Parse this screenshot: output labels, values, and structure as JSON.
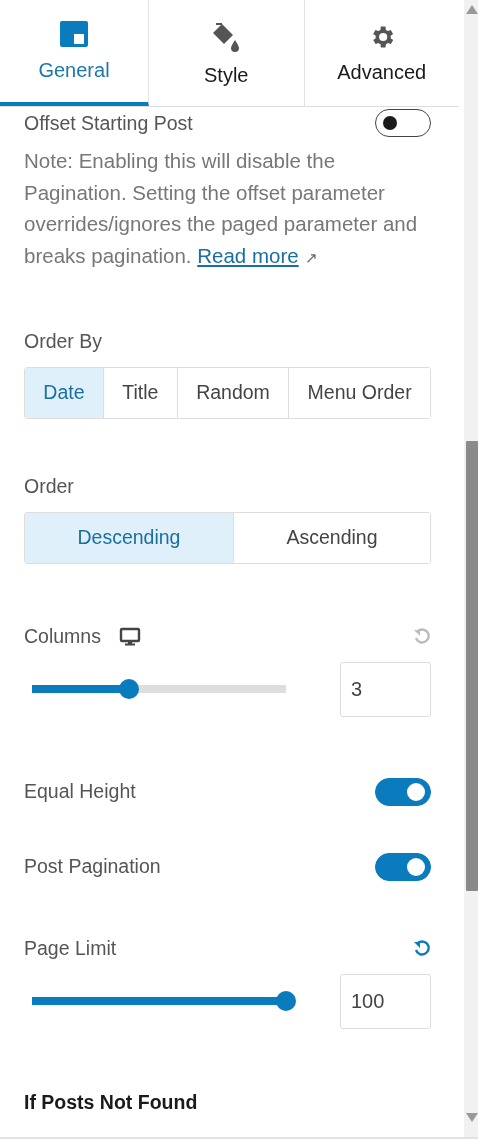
{
  "tabs": [
    {
      "label": "General",
      "kind": "layout",
      "selected": true
    },
    {
      "label": "Style",
      "kind": "paint",
      "selected": false
    },
    {
      "label": "Advanced",
      "kind": "gear",
      "selected": false
    }
  ],
  "controls": [
    {
      "kind": "toggle",
      "label": "Offset Starting Post",
      "on": false
    },
    {
      "kind": "note",
      "text": "Note: Enabling this will disable the Pagination. Setting the offset parameter overrides/ignores the paged parameter and breaks pagination.",
      "link": "Read more",
      "link_icon": "↗"
    },
    {
      "kind": "segmented",
      "label": "Order By",
      "options": [
        {
          "label": "Date",
          "selected": true
        },
        {
          "label": "Title",
          "selected": false
        },
        {
          "label": "Random",
          "selected": false
        },
        {
          "label": "Menu Order",
          "selected": false
        }
      ]
    },
    {
      "kind": "segmented",
      "label": "Order",
      "options": [
        {
          "label": "Descending",
          "selected": true
        },
        {
          "label": "Ascending",
          "selected": false
        }
      ]
    },
    {
      "kind": "slider",
      "label": "Columns",
      "responsive": true,
      "reset_active": false,
      "level": 0.38,
      "value": "3"
    },
    {
      "kind": "toggle",
      "label": "Equal Height",
      "on": true
    },
    {
      "kind": "toggle",
      "label": "Post Pagination",
      "on": true
    },
    {
      "kind": "slider",
      "label": "Page Limit",
      "responsive": false,
      "reset_active": true,
      "level": 1,
      "value": "100"
    },
    {
      "kind": "heading",
      "label": "If Posts Not Found"
    }
  ]
}
